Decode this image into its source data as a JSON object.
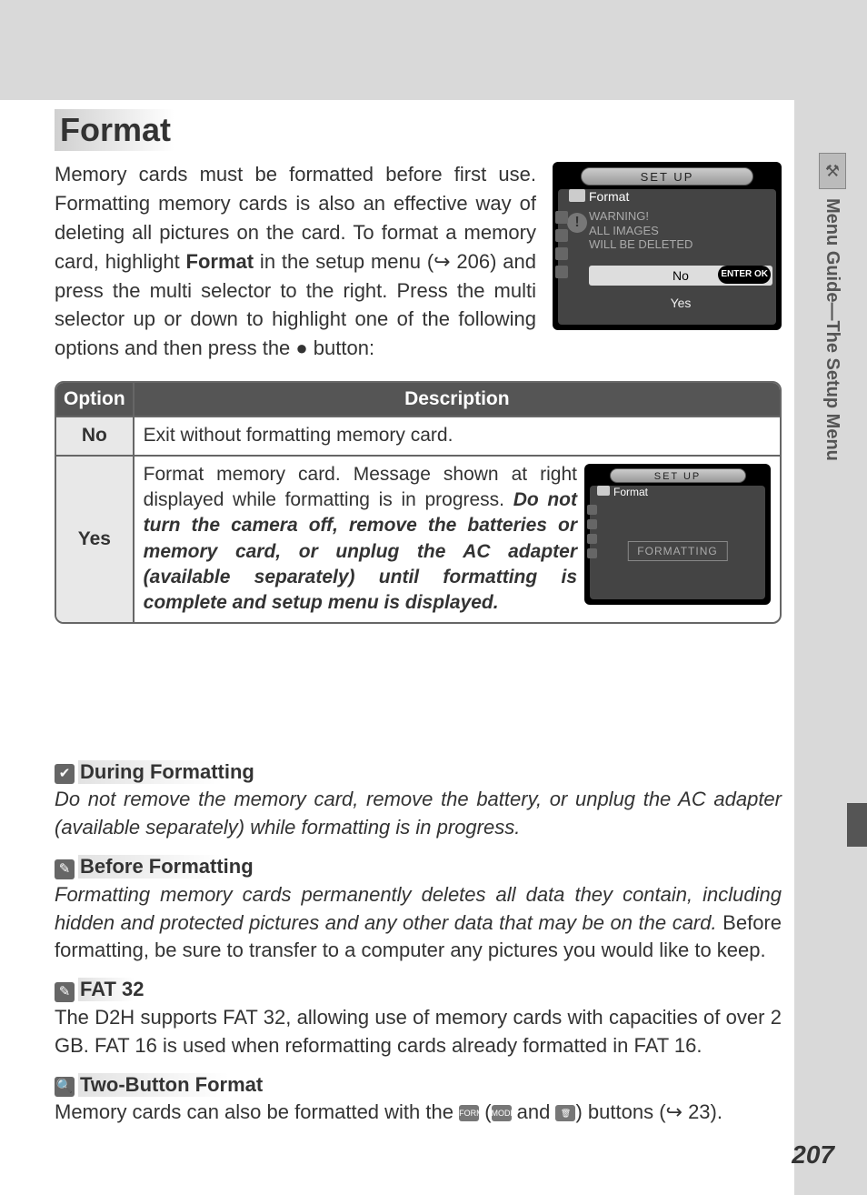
{
  "title": "Format",
  "intro_html": "Memory cards must be formatted before first use. Formatting memory cards is also an effective way of deleting all pictures on the card.  To format a memory card, highlight <b>Format</b> in the setup menu (↪ 206) and press the multi selector to the right.  Press the multi selector up or down to highlight one of the following options and then press the ● button:",
  "screenshot1": {
    "title": "SET  UP",
    "subtitle": "Format",
    "warning_line1": "WARNING!",
    "warning_line2": "ALL IMAGES",
    "warning_line3": "WILL BE DELETED",
    "option_no": "No",
    "option_yes": "Yes",
    "ok_label": "ENTER OK"
  },
  "table": {
    "header_option": "Option",
    "header_desc": "Description",
    "rows": [
      {
        "option": "No",
        "desc_html": "Exit without formatting memory card."
      },
      {
        "option": "Yes",
        "desc_html": "Format memory card.  Message shown at right displayed while formatting is in progress.   <b><i>Do not turn the camera off, remove the batteries or memory card, or unplug the AC adapter (available separately) until formatting is complete and setup menu is displayed.</i></b>"
      }
    ]
  },
  "screenshot2": {
    "title": "SET  UP",
    "format_label": "Format",
    "formatting_label": "FORMATTING"
  },
  "notes": [
    {
      "icon": "v",
      "heading": "During Formatting",
      "body_html": "<i>Do not remove the memory card, remove the battery, or unplug the AC adapter (available separately) while formatting is in progress.</i>"
    },
    {
      "icon": "pencil",
      "heading": "Before Formatting",
      "body_html": "<i>Formatting memory cards permanently deletes all data they contain, including hidden and protected pictures and any other data that may be on the card.</i> Before formatting, be sure to transfer to a computer any pictures you would like to keep."
    },
    {
      "icon": "pencil",
      "heading": "FAT 32",
      "body_html": "The D2H supports FAT 32, allowing use of memory cards with capacities of over 2 GB. FAT 16 is used when reformatting cards already formatted in FAT 16."
    },
    {
      "icon": "mag",
      "heading": "Two-Button Format",
      "body_html": "Memory cards can also be formatted with the <span class='inline-icon' data-name='format-badge-icon'>FORMAT</span> (<span class='inline-icon' data-name='mode-icon'>MODE</span> and <span class='inline-icon trash' data-name='trash-icon'>🗑</span>) buttons (↪ 23)."
    }
  ],
  "side_tab_label": "Menu Guide—The Setup Menu",
  "page_number": "207"
}
